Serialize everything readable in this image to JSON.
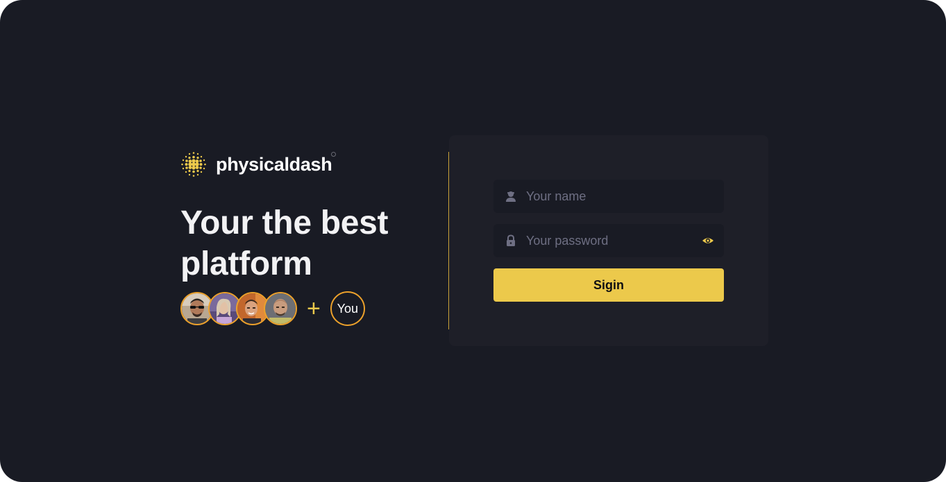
{
  "brand": {
    "name": "physicaldash",
    "logo_icon": "dot-grid-logo-icon",
    "accent": "#ecc94b"
  },
  "hero": {
    "headline_line1": "Your the best",
    "headline_line2": "platform",
    "plus": "+",
    "you_label": "You",
    "avatar_ring_color": "#eca12b"
  },
  "login": {
    "name_placeholder": "Your name",
    "name_icon": "user-icon",
    "password_placeholder": "Your password",
    "password_icon": "lock-icon",
    "toggle_icon": "eye-icon",
    "submit_label": "Sigin"
  },
  "colors": {
    "background": "#191b24",
    "card": "#1e1f28",
    "field": "#191b24",
    "button": "#ecc94b",
    "divider": "#c9a23a"
  }
}
